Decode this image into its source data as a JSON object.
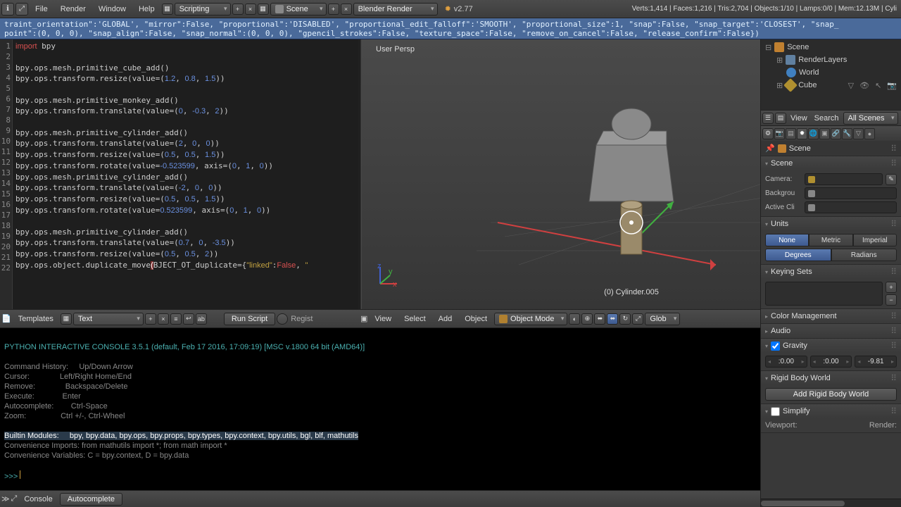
{
  "topbar": {
    "menus": [
      "File",
      "Render",
      "Window",
      "Help"
    ],
    "layout_label": "Scripting",
    "scene_label": "Scene",
    "engine_label": "Blender Render",
    "version": "v2.77",
    "stats": "Verts:1,414 | Faces:1,216 | Tris:2,704 | Objects:1/10 | Lamps:0/0 | Mem:12.13M | Cyli"
  },
  "infobar_text": "traint_orientation\":'GLOBAL', \"mirror\":False, \"proportional\":'DISABLED', \"proportional_edit_falloff\":'SMOOTH', \"proportional_size\":1, \"snap\":False, \"snap_target\":'CLOSEST', \"snap_\npoint\":(0, 0, 0), \"snap_align\":False, \"snap_normal\":(0, 0, 0), \"gpencil_strokes\":False, \"texture_space\":False, \"remove_on_cancel\":False, \"release_confirm\":False})",
  "text_editor": {
    "lines": 22,
    "code_html": "<span class='k-red'>import</span> bpy\n\nbpy.ops.mesh.primitive_cube_add()\nbpy.ops.transform.resize(value=(<span class='k-blue'>1.2</span>, <span class='k-blue'>0.8</span>, <span class='k-blue'>1.5</span>))\n\nbpy.ops.mesh.primitive_monkey_add()\nbpy.ops.transform.translate(value=(<span class='k-blue'>0</span>, <span class='k-blue'>-0.3</span>, <span class='k-blue'>2</span>))\n\nbpy.ops.mesh.primitive_cylinder_add()\nbpy.ops.transform.translate(value=(<span class='k-blue'>2</span>, <span class='k-blue'>0</span>, <span class='k-blue'>0</span>))\nbpy.ops.transform.resize(value=(<span class='k-blue'>0.5</span>, <span class='k-blue'>0.5</span>, <span class='k-blue'>1.5</span>))\nbpy.ops.transform.rotate(value=<span class='k-blue'>-0.523599</span>, axis=(<span class='k-blue'>0</span>, <span class='k-blue'>1</span>, <span class='k-blue'>0</span>))\nbpy.ops.mesh.primitive_cylinder_add()\nbpy.ops.transform.translate(value=(<span class='k-blue'>-2</span>, <span class='k-blue'>0</span>, <span class='k-blue'>0</span>))\nbpy.ops.transform.resize(value=(<span class='k-blue'>0.5</span>, <span class='k-blue'>0.5</span>, <span class='k-blue'>1.5</span>))\nbpy.ops.transform.rotate(value=<span class='k-blue'>0.523599</span>, axis=(<span class='k-blue'>0</span>, <span class='k-blue'>1</span>, <span class='k-blue'>0</span>))\n\nbpy.ops.mesh.primitive_cylinder_add()\nbpy.ops.transform.translate(value=(<span class='k-blue'>0.7</span>, <span class='k-blue'>0</span>, <span class='k-blue'>-3.5</span>))\nbpy.ops.transform.resize(value=(<span class='k-blue'>0.5</span>, <span class='k-blue'>0.5</span>, <span class='k-blue'>2</span>))\nbpy.ops.object.duplicate_move<span style='background:#803030;color:#fff'>(</span>BJECT_OT_duplicate={<span class='k-yel'>\"linked\"</span>:<span class='k-red'>False</span>, <span class='k-yel'>\"</span>",
    "footer": {
      "templates": "Templates",
      "datablock": "Text",
      "run": "Run Script",
      "register": "Regist"
    }
  },
  "viewport": {
    "persp": "User Persp",
    "obj_label": "(0) Cylinder.005",
    "footer": {
      "view": "View",
      "select": "Select",
      "add": "Add",
      "object": "Object",
      "mode": "Object Mode",
      "global": "Glob"
    }
  },
  "console": {
    "header": "PYTHON INTERACTIVE CONSOLE 3.5.1 (default, Feb 17 2016, 17:09:19) [MSC v.1800 64 bit (AMD64)]",
    "lines": [
      [
        "Command History:",
        "Up/Down Arrow"
      ],
      [
        "Cursor:",
        "Left/Right Home/End"
      ],
      [
        "Remove:",
        "Backspace/Delete"
      ],
      [
        "Execute:",
        "Enter"
      ],
      [
        "Autocomplete:",
        "Ctrl-Space"
      ],
      [
        "Zoom:",
        "Ctrl +/-, Ctrl-Wheel"
      ]
    ],
    "builtin": "Builtin Modules:     bpy, bpy.data, bpy.ops, bpy.props, bpy.types, bpy.context, bpy.utils, bgl, blf, mathutils",
    "conv1": "Convenience Imports: from mathutils import *; from math import *",
    "conv2": "Convenience Variables: C = bpy.context, D = bpy.data",
    "prompt": ">>> ",
    "footer": {
      "console": "Console",
      "auto": "Autocomplete"
    }
  },
  "outliner": {
    "scene": "Scene",
    "renderlayers": "RenderLayers",
    "world": "World",
    "cube": "Cube",
    "search": {
      "view": "View",
      "search": "Search",
      "all": "All Scenes"
    }
  },
  "props": {
    "breadcrumb": "Scene",
    "scene": {
      "title": "Scene",
      "camera": "Camera:",
      "background": "Backgrou",
      "active": "Active Cli"
    },
    "units": {
      "title": "Units",
      "none": "None",
      "metric": "Metric",
      "imperial": "Imperial",
      "degrees": "Degrees",
      "radians": "Radians"
    },
    "keying": {
      "title": "Keying Sets"
    },
    "colormgmt": "Color Management",
    "audio": "Audio",
    "gravity": {
      "title": "Gravity",
      "x": ":0.00",
      "y": ":0.00",
      "z": "-9.81"
    },
    "rigid": {
      "title": "Rigid Body World",
      "btn": "Add Rigid Body World"
    },
    "simplify": "Simplify",
    "vp_render": {
      "viewport": "Viewport:",
      "render": "Render:"
    }
  }
}
